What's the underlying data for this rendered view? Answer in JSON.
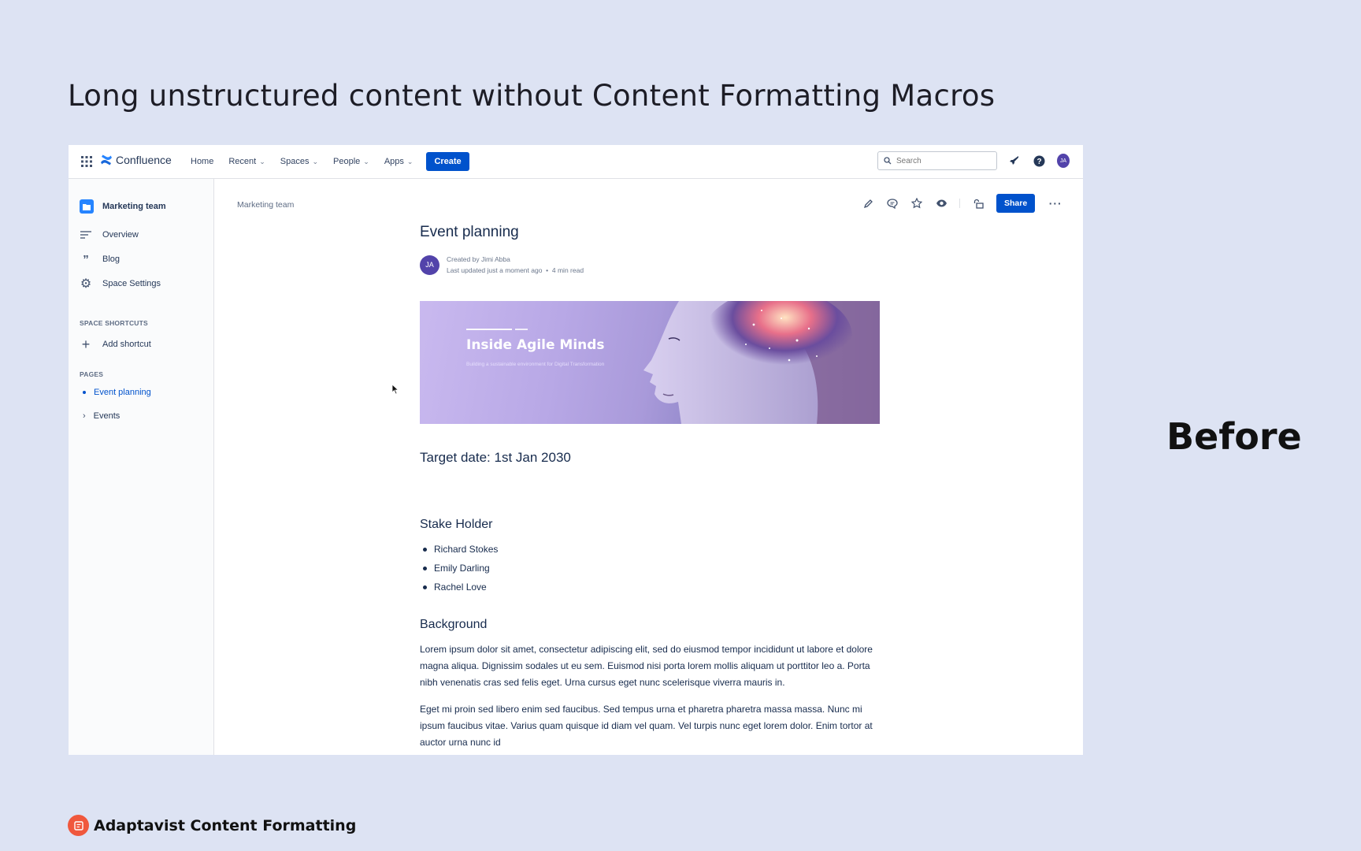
{
  "slide": {
    "title": "Long unstructured content without Content Formatting Macros",
    "side_label": "Before",
    "brand": "Adaptavist Content Formatting"
  },
  "topbar": {
    "logo": "Confluence",
    "nav": [
      {
        "label": "Home"
      },
      {
        "label": "Recent"
      },
      {
        "label": "Spaces"
      },
      {
        "label": "People"
      },
      {
        "label": "Apps"
      }
    ],
    "create_label": "Create",
    "search_placeholder": "Search",
    "avatar_initials": "JA"
  },
  "sidebar": {
    "space_name": "Marketing team",
    "items": [
      {
        "label": "Overview",
        "icon": "overview-icon"
      },
      {
        "label": "Blog",
        "icon": "quote-icon"
      },
      {
        "label": "Space Settings",
        "icon": "gear-icon"
      }
    ],
    "shortcuts_heading": "SPACE SHORTCUTS",
    "add_shortcut": "Add shortcut",
    "pages_heading": "PAGES",
    "pages": [
      {
        "label": "Event planning",
        "active": true
      },
      {
        "label": "Events",
        "active": false
      }
    ]
  },
  "page": {
    "breadcrumb": "Marketing team",
    "share_label": "Share",
    "title": "Event planning",
    "author_initials": "JA",
    "created_by": "Created by Jimi Abba",
    "last_updated": "Last updated just a moment ago",
    "read_time": "4 min read",
    "banner": {
      "title": "Inside Agile Minds",
      "subtitle": "Building a sustainable environment for Digital Transformation"
    },
    "target_date": "Target date: 1st Jan 2030",
    "stakeholder_heading": "Stake Holder",
    "stakeholders": [
      "Richard Stokes",
      "Emily Darling",
      "Rachel Love"
    ],
    "background_heading": "Background",
    "paragraphs": [
      "Lorem ipsum dolor sit amet, consectetur adipiscing elit, sed do eiusmod tempor incididunt ut labore et dolore magna aliqua. Dignissim sodales ut eu sem. Euismod nisi porta lorem mollis aliquam ut porttitor leo a. Porta nibh venenatis cras sed felis eget. Urna cursus eget nunc scelerisque viverra mauris in.",
      "Eget mi proin sed libero enim sed faucibus. Sed tempus urna et pharetra pharetra massa massa. Nunc mi ipsum faucibus vitae. Varius quam quisque id diam vel quam. Vel turpis nunc eget lorem dolor. Enim tortor at auctor urna nunc id"
    ]
  },
  "colors": {
    "background": "#dde3f3",
    "primary": "#0052cc",
    "text": "#172b4d",
    "avatar": "#5243aa",
    "brand": "#f0583d"
  }
}
